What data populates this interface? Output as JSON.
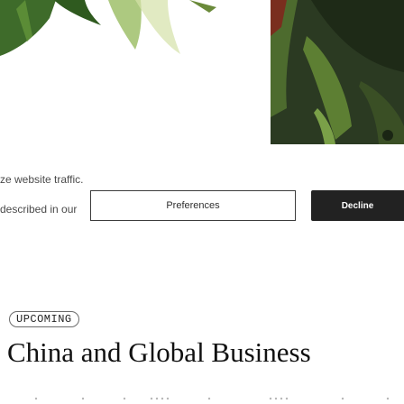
{
  "cookie_banner": {
    "line1": "ze website traffic.",
    "line2": "described in our",
    "preferences_label": "Preferences",
    "decline_label": "Decline"
  },
  "article": {
    "tag": "UPCOMING",
    "headline": "China and Global Business"
  },
  "colors": {
    "decline_bg": "#222222",
    "text_dark": "#111111",
    "text_muted": "#4a4a4a"
  }
}
